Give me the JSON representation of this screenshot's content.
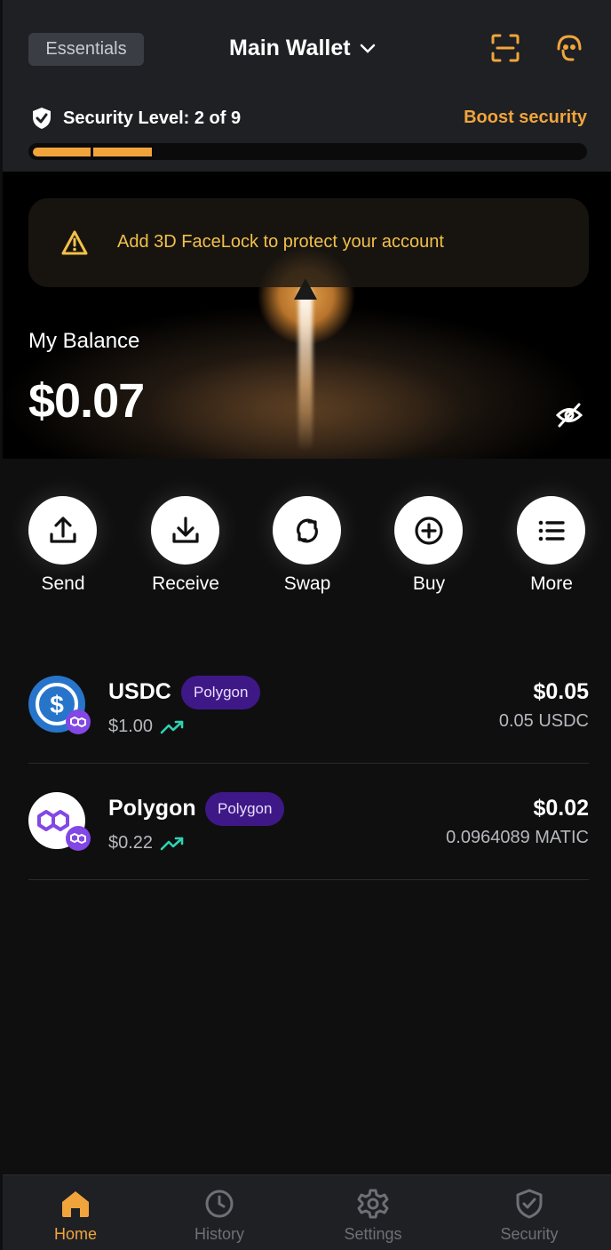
{
  "header": {
    "essentials_label": "Essentials",
    "wallet_name": "Main Wallet",
    "security_text": "Security Level: 2 of 9",
    "boost_label": "Boost security",
    "security_level": 2,
    "security_max": 9
  },
  "alert": {
    "text": "Add 3D FaceLock to protect your account"
  },
  "balance": {
    "label": "My Balance",
    "value": "$0.07"
  },
  "actions": [
    {
      "label": "Send",
      "icon": "upload-icon"
    },
    {
      "label": "Receive",
      "icon": "download-icon"
    },
    {
      "label": "Swap",
      "icon": "swap-icon"
    },
    {
      "label": "Buy",
      "icon": "plus-circle-icon"
    },
    {
      "label": "More",
      "icon": "list-icon"
    }
  ],
  "tokens": [
    {
      "name": "USDC",
      "network": "Polygon",
      "price": "$1.00",
      "usd_value": "$0.05",
      "amount": "0.05 USDC"
    },
    {
      "name": "Polygon",
      "network": "Polygon",
      "price": "$0.22",
      "usd_value": "$0.02",
      "amount": "0.0964089 MATIC"
    }
  ],
  "nav": [
    {
      "label": "Home",
      "active": true
    },
    {
      "label": "History",
      "active": false
    },
    {
      "label": "Settings",
      "active": false
    },
    {
      "label": "Security",
      "active": false
    }
  ],
  "colors": {
    "accent": "#f1a43c",
    "warning": "#f2c04b",
    "network_tag": "#3f1887",
    "polygon": "#8247e5",
    "usdc": "#2775ca",
    "trend": "#2fd3b1"
  }
}
